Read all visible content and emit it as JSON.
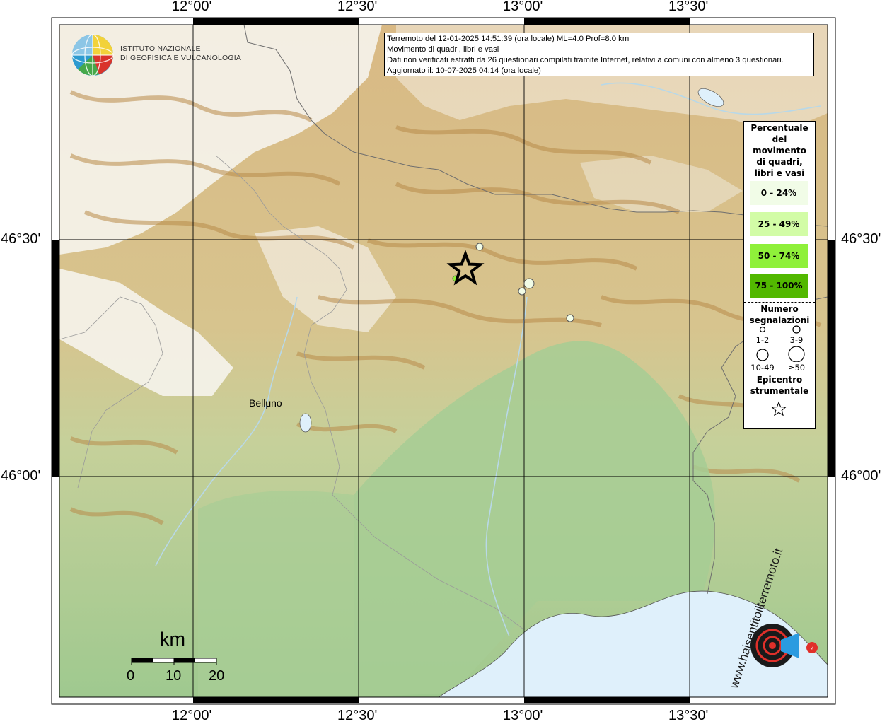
{
  "map": {
    "longitude_labels": [
      "12°00'",
      "12°30'",
      "13°00'",
      "13°30'"
    ],
    "latitude_labels": [
      "46°30'",
      "46°00'"
    ],
    "city_label": "Belluno"
  },
  "logo": {
    "line1": "ISTITUTO NAZIONALE",
    "line2": "DI GEOFISICA E VULCANOLOGIA"
  },
  "info": {
    "line1": "Terremoto del 12-01-2025 14:51:39 (ora locale) ML=4.0 Prof=8.0 km",
    "line2": "Movimento di quadri, libri e vasi",
    "line3": "Dati non verificati estratti da 26 questionari compilati tramite Internet, relativi a comuni con almeno 3 questionari.",
    "line4": "Aggiornato il: 10-07-2025 04:14 (ora locale)"
  },
  "legend": {
    "title_lines": [
      "Percentuale",
      "del",
      "movimento",
      "di quadri,",
      "libri e vasi"
    ],
    "classes": [
      {
        "label": "0 - 24%",
        "color": "#f1fce7"
      },
      {
        "label": "25 - 49%",
        "color": "#d2fca6"
      },
      {
        "label": "50 - 74%",
        "color": "#8ff03a"
      },
      {
        "label": "75 - 100%",
        "color": "#52b800"
      }
    ],
    "count_title_lines": [
      "Numero",
      "segnalazioni"
    ],
    "count_classes": [
      "1-2",
      "3-9",
      "10-49",
      "≥50"
    ],
    "epicenter_title_lines": [
      "Epicentro",
      "strumentale"
    ]
  },
  "scale": {
    "unit": "km",
    "labels": [
      "0",
      "10",
      "20"
    ]
  },
  "watermark": {
    "text": "www.haisentitoilterremoto.it"
  },
  "colors": {
    "plain_green": "#9fc98f",
    "hill_tan": "#c9a064",
    "snow": "#fbfbf8",
    "sea": "#dff0fb"
  }
}
